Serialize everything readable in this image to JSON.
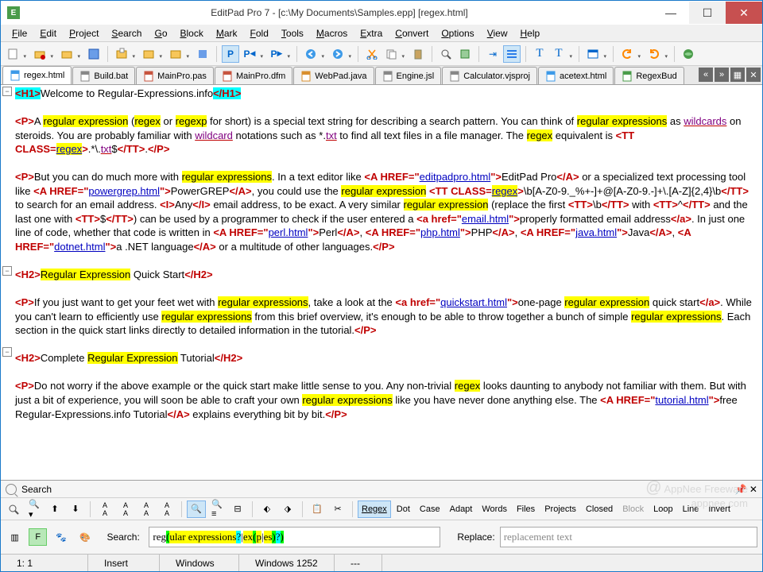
{
  "title": "EditPad Pro 7 - [c:\\My Documents\\Samples.epp] [regex.html]",
  "menu": [
    "File",
    "Edit",
    "Project",
    "Search",
    "Go",
    "Block",
    "Mark",
    "Fold",
    "Tools",
    "Macros",
    "Extra",
    "Convert",
    "Options",
    "View",
    "Help"
  ],
  "tabs": [
    {
      "label": "regex.html",
      "icon": "html",
      "active": true
    },
    {
      "label": "Build.bat",
      "icon": "bat"
    },
    {
      "label": "MainPro.pas",
      "icon": "pas"
    },
    {
      "label": "MainPro.dfm",
      "icon": "dfm"
    },
    {
      "label": "WebPad.java",
      "icon": "java"
    },
    {
      "label": "Engine.jsl",
      "icon": "jsl"
    },
    {
      "label": "Calculator.vjsproj",
      "icon": "proj"
    },
    {
      "label": "acetext.html",
      "icon": "html"
    },
    {
      "label": "RegexBud",
      "icon": "app"
    }
  ],
  "search_panel": {
    "title": "Search",
    "buttons": [
      "Regex",
      "Dot",
      "Case",
      "Adapt",
      "Words",
      "Files",
      "Projects",
      "Closed",
      "Block",
      "Loop",
      "Line",
      "Invert"
    ],
    "search_label": "Search:",
    "replace_label": "Replace:",
    "search_value_parts": [
      {
        "t": "reg",
        "c": ""
      },
      {
        "t": "(",
        "c": "p1"
      },
      {
        "t": "ular expressions",
        "c": "p2"
      },
      {
        "t": "?",
        "c": "p3"
      },
      {
        "t": "|",
        "c": ""
      },
      {
        "t": "ex",
        "c": "p2"
      },
      {
        "t": "(",
        "c": "p1"
      },
      {
        "t": "p",
        "c": "p2"
      },
      {
        "t": "|",
        "c": ""
      },
      {
        "t": "es",
        "c": "p2"
      },
      {
        "t": ")",
        "c": "p1"
      },
      {
        "t": "?",
        "c": "p3"
      },
      {
        "t": ")",
        "c": "p1"
      }
    ],
    "replace_placeholder": "replacement text"
  },
  "status": {
    "pos": "1: 1",
    "mode": "Insert",
    "eol": "Windows",
    "enc": "Windows 1252",
    "extra": "---"
  },
  "content": {
    "h1_open": "<H1>",
    "h1_text": "Welcome to Regular-Expressions.info",
    "h1_close": "</H1>",
    "p1_open": "<P>",
    "p1_a": "A ",
    "re": "regular expression",
    "res": "regular expressions",
    "p1_paren": " (",
    "regex_hl": "regex",
    "p1_or": " or ",
    "regexp_hl": "regexp",
    "p1_b": " for short) is a special text string for describing a search pattern.  You can think of ",
    "p1_c": " as ",
    "wildcards": "wildcards",
    "p1_d": " on steroids.  You are probably familiar with ",
    "wildcard": "wildcard",
    "p1_e": " notations such as *.",
    "txt": "txt",
    "p1_f": " to find all text files in a file manager.  The ",
    "p1_g": " equivalent is ",
    "tt_open": "<TT CLASS=",
    "tt_regex": "regex",
    "tt_close": ">",
    "tt_body": ".*\\.",
    "tt_txt": "txt",
    "tt_dollar": "$",
    "tt_end": "</TT>",
    "p_close": "</P>",
    "p2_a": "But you can do much more with ",
    "p2_b": ".  In a text editor like ",
    "a_editpad": "editpadpro.html",
    "editpad": "EditPad Pro",
    "p2_c": " or a specialized text processing tool like ",
    "a_pg": "powergrep.html",
    "powergrep": "PowerGREP",
    "p2_d": ", you could use the ",
    "regex_pattern": "\\b[A-Z0-9._%+-]+@[A-Z0-9.-]+\\.[A-Z]{2,4}\\b",
    "p2_e": " to search for an email address.  ",
    "i_open": "<I>",
    "any": "Any",
    "i_close": "</I>",
    "p2_f": " email address, to be exact.  A very similar ",
    "p2_g": " (replace the first ",
    "tt_b": "\\b",
    "p2_with": " with ",
    "tt_caret": "^",
    "p2_last": " and the last one with ",
    "tt_dol": "$",
    "p2_h": ") can be used by a programmer to check if the user entered a ",
    "a_email": "email.html",
    "email_txt": "properly formatted email address",
    "p2_i": ".  In just one line of code, whether that code is written in ",
    "a_perl": "perl.html",
    "perl": "Perl",
    "a_php": "php.html",
    "php": "PHP",
    "a_java": "java.html",
    "java": "Java",
    "a_dotnet": "dotnet.html",
    "dotnet": "a .NET language",
    "p2_j": " or a multitude of other languages.",
    "h2a_open": "<H2>",
    "h2a_txt1": "Regular Expression",
    "h2a_txt2": " Quick Start",
    "h2a_close": "</H2>",
    "p3_a": "If you just want to get your feet wet with ",
    "p3_b": ", take a look at the ",
    "a_qs": "quickstart.html",
    "qs_txt": "one-page ",
    "p3_c": " quick start",
    "p3_d": ".  While you can't learn to efficiently use ",
    "p3_e": " from this brief overview, it's enough to be able to throw together a bunch of simple ",
    "p3_f": ".  Each section in the quick start links directly to detailed information in the tutorial.",
    "h2b_txt1": "Complete ",
    "h2b_txt2": "Regular Expression",
    "h2b_txt3": " Tutorial",
    "p4_a": "Do not worry if the above example or the quick start make little sense to you.  Any non-trivial ",
    "p4_b": " looks daunting to anybody not familiar with them.  But with just a bit of experience, you will soon be able to craft your own ",
    "p4_c": " like you have never done anything else.  The ",
    "a_tut": "tutorial.html",
    "tut_txt": "free Regular-Expressions.info Tutorial",
    "p4_d": " explains everything bit by bit."
  }
}
